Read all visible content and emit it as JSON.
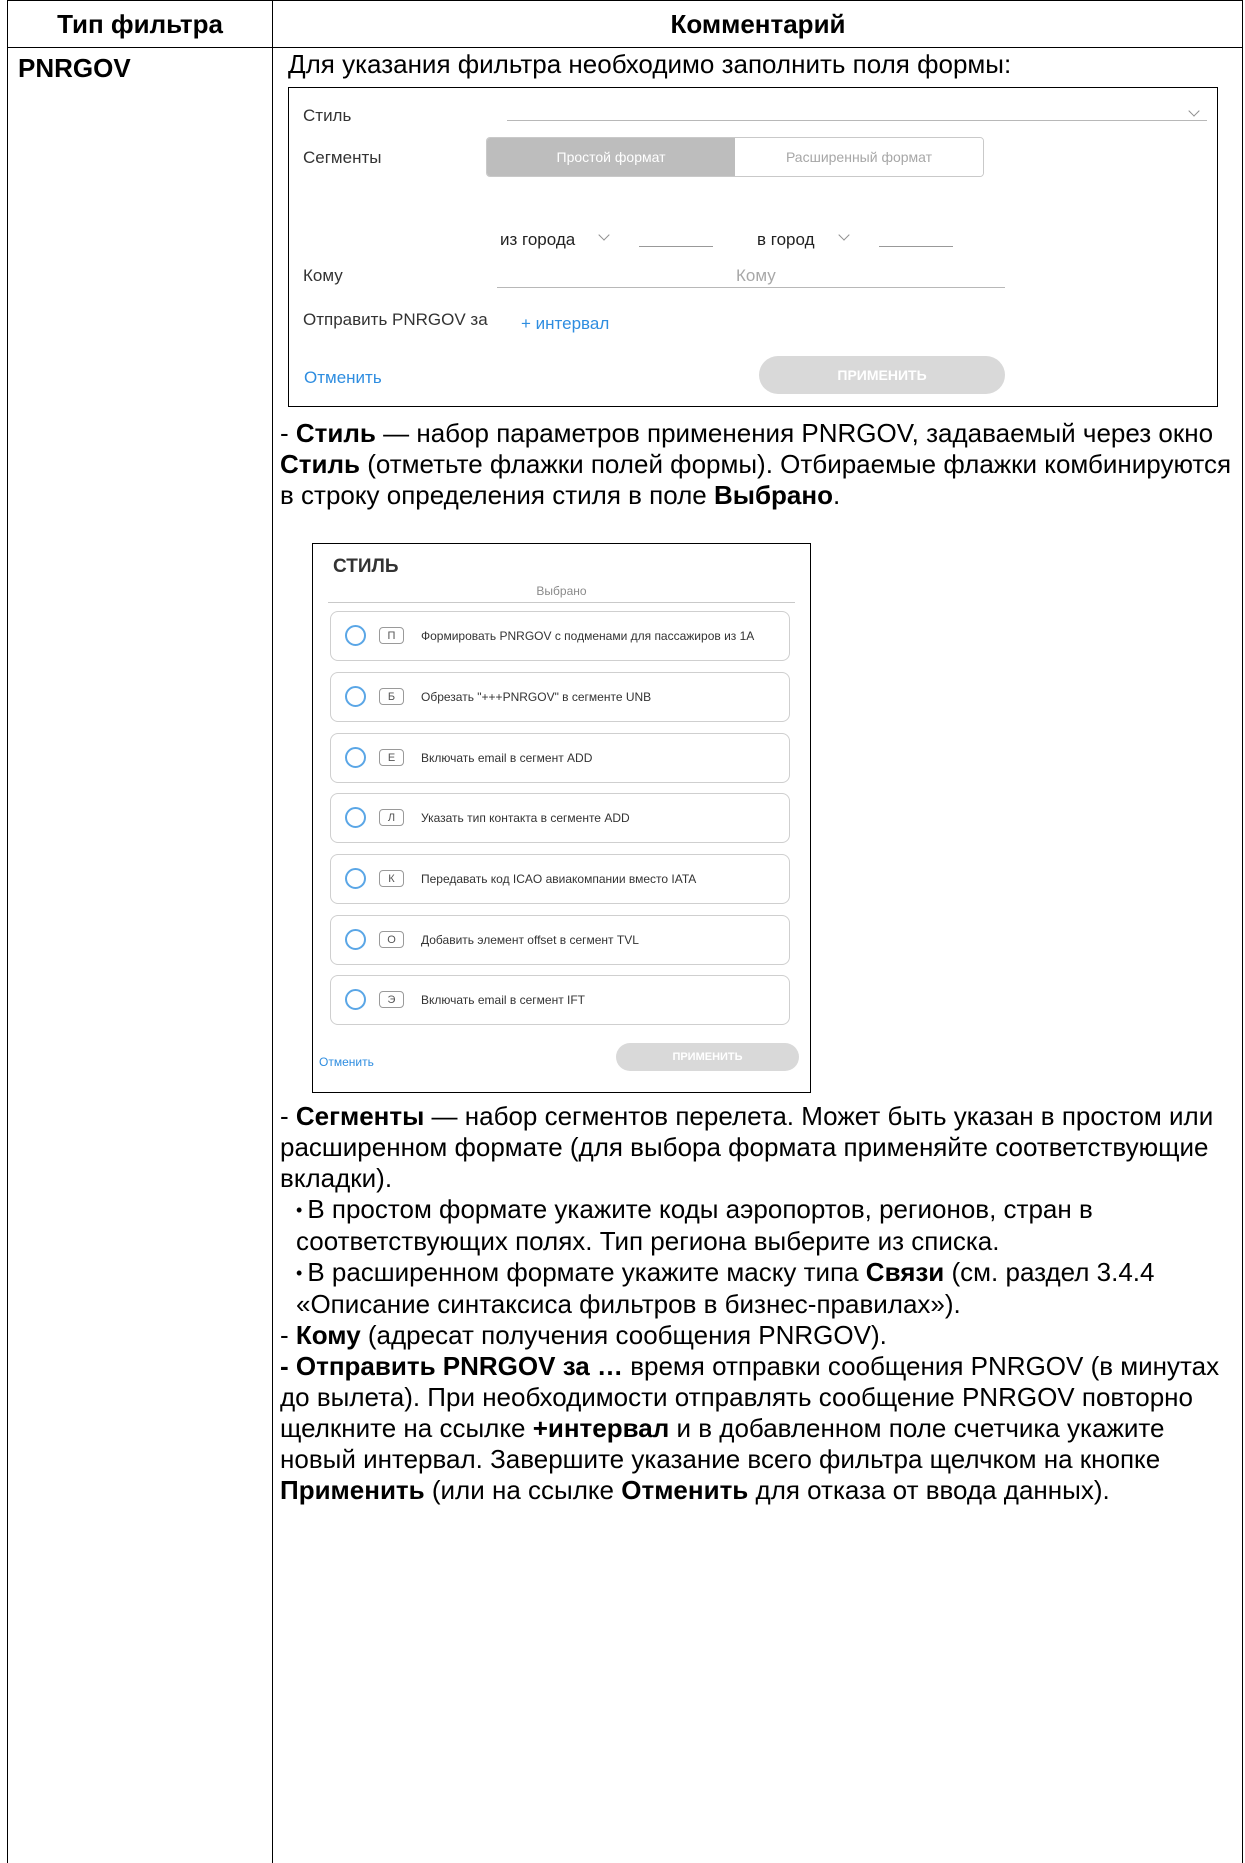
{
  "table": {
    "header_type": "Тип фильтра",
    "header_comment": "Комментарий",
    "filter_type": "PNRGOV"
  },
  "intro": "Для указания фильтра необходимо заполнить поля формы:",
  "form": {
    "style_label": "Стиль",
    "segments_label": "Сегменты",
    "tab_simple": "Простой формат",
    "tab_extended": "Расширенный формат",
    "from_city": "из города",
    "to_city": "в город",
    "to_label": "Кому",
    "to_placeholder": "Кому",
    "send_label": "Отправить PNRGOV за",
    "interval_link": "+ интервал",
    "cancel": "Отменить",
    "apply": "ПРИМЕНИТЬ"
  },
  "style_para": {
    "dash": "- ",
    "b1": "Стиль",
    "t1": " — набор параметров применения PNRGOV, задаваемый через окно ",
    "b2": "Стиль",
    "t2": " (отметьте флажки полей формы). Отбираемые флажки комбинируются в строку определения стиля в поле ",
    "b3": "Выбрано",
    "t3": "."
  },
  "style_dialog": {
    "title": "СТИЛЬ",
    "selected_label": "Выбрано",
    "options": [
      {
        "key": "П",
        "text": "Формировать PNRGOV с подменами для пассажиров из 1А"
      },
      {
        "key": "Б",
        "text": "Обрезать \"+++PNRGOV\" в сегменте UNB"
      },
      {
        "key": "Е",
        "text": "Включать email в сегмент ADD"
      },
      {
        "key": "Л",
        "text": "Указать тип контакта в сегменте ADD"
      },
      {
        "key": "К",
        "text": "Передавать код ICAO авиакомпании вместо IATA"
      },
      {
        "key": "О",
        "text": "Добавить элемент offset в сегмент TVL"
      },
      {
        "key": "Э",
        "text": "Включать email в сегмент IFT"
      }
    ],
    "cancel": "Отменить",
    "apply": "ПРИМЕНИТЬ"
  },
  "segments_para": {
    "dash": "- ",
    "b1": "Сегменты",
    "t1": " — набор сегментов перелета. Может быть указан в простом или расширенном формате (для выбора формата применяйте соответствующие вкладки).",
    "bullet1": "В простом формате укажите коды аэропортов, регионов, стран в соответствующих полях. Тип региона выберите из списка.",
    "bullet2_pre": "В расширенном формате укажите маску типа ",
    "bullet2_b": "Связи",
    "bullet2_post": " (см. раздел 3.4.4 «Описание синтаксиса фильтров в бизнес-правилах»)."
  },
  "to_para": {
    "dash": "- ",
    "b1": "Кому",
    "t1": " (адресат получения сообщения PNRGOV)."
  },
  "send_para": {
    "b1": "- Отправить PNRGOV за …",
    "t1": " время отправки сообщения PNRGOV (в минутах до вылета). При необходимости отправлять сообщение PNRGOV повторно щелкните на ссылке ",
    "b2": "+интервал",
    "t2": " и в добавленном поле счетчика укажите новый интервал. Завершите указание всего фильтра щелчком на кнопке ",
    "b3": "Применить",
    "t3": " (или на ссылке ",
    "b4": "Отменить",
    "t4": " для отказа от ввода данных)."
  }
}
